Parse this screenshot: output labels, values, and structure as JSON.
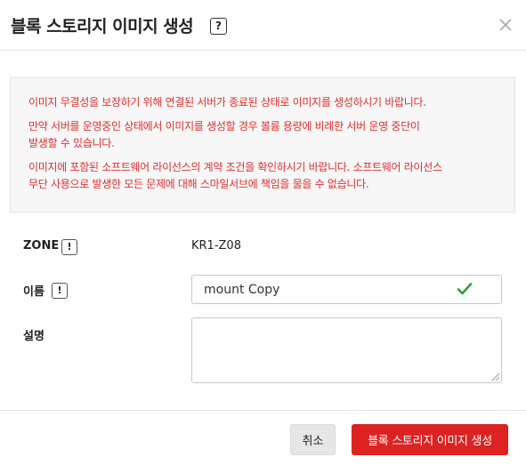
{
  "dialog": {
    "title": "블록 스토리지 이미지 생성",
    "help_symbol": "?"
  },
  "notice": {
    "line1": "이미지 무결성을 보장하기 위해 연결된 서버가 종료된 상태로 이미지를 생성하시기 바랍니다.",
    "line2a": "만약 서버를 운영중인 상태에서 이미지를 생성할 경우 볼륨 용량에 비례한 서버 운영 중단이",
    "line2b": "발생할 수 있습니다.",
    "line3a": "이미지에 포함된 소프트웨어 라이선스의 계약 조건을 확인하시기 바랍니다. 소프트웨어 라이선스",
    "line3b": "무단 사용으로 발생한 모든 문제에 대해 스마일서브에 책임을 물을 수 없습니다.",
    "text_color": "#e03030"
  },
  "form": {
    "zone_label": "ZONE",
    "zone_value": "KR1-Z08",
    "name_label": "이름",
    "name_value": "mount Copy",
    "desc_label": "설명",
    "desc_value": "",
    "info_symbol": "!"
  },
  "footer": {
    "cancel_label": "취소",
    "create_label": "블록 스토리지 이미지 생성",
    "accent_color": "#dd2222"
  },
  "icons": {
    "close": "close-icon",
    "check": "check-icon",
    "help": "help-icon",
    "info": "info-icon"
  }
}
